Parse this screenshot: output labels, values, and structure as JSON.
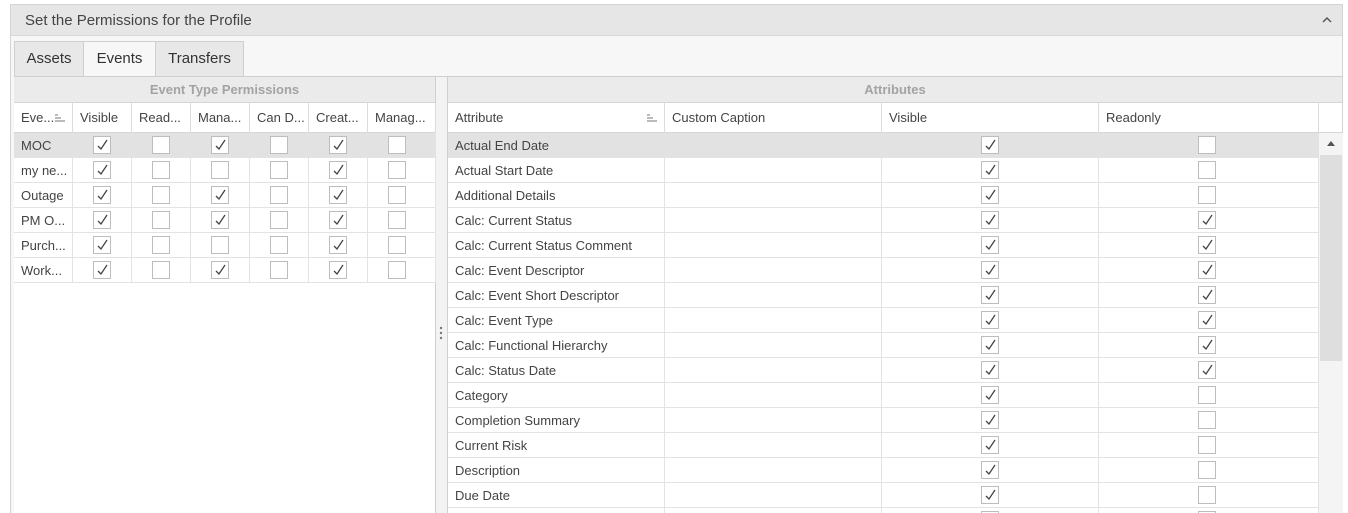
{
  "panel": {
    "title": "Set the Permissions for the Profile"
  },
  "tabs": [
    {
      "label": "Assets",
      "active": false
    },
    {
      "label": "Events",
      "active": true
    },
    {
      "label": "Transfers",
      "active": false
    }
  ],
  "left": {
    "band": "Event Type Permissions",
    "columns": [
      "Eve...",
      "Visible",
      "Read...",
      "Mana...",
      "Can D...",
      "Creat...",
      "Manag..."
    ],
    "rows": [
      {
        "name": "MOC",
        "checks": [
          true,
          false,
          true,
          false,
          true,
          false
        ],
        "selected": true
      },
      {
        "name": "my ne...",
        "checks": [
          true,
          false,
          false,
          false,
          true,
          false
        ],
        "selected": false
      },
      {
        "name": "Outage",
        "checks": [
          true,
          false,
          true,
          false,
          true,
          false
        ],
        "selected": false
      },
      {
        "name": "PM O...",
        "checks": [
          true,
          false,
          true,
          false,
          true,
          false
        ],
        "selected": false
      },
      {
        "name": "Purch...",
        "checks": [
          true,
          false,
          false,
          false,
          true,
          false
        ],
        "selected": false
      },
      {
        "name": "Work...",
        "checks": [
          true,
          false,
          true,
          false,
          true,
          false
        ],
        "selected": false
      }
    ]
  },
  "right": {
    "band": "Attributes",
    "columns": [
      "Attribute",
      "Custom Caption",
      "Visible",
      "Readonly"
    ],
    "rows": [
      {
        "attribute": "Actual End Date",
        "caption": "",
        "visible": true,
        "readonly": false,
        "selected": true
      },
      {
        "attribute": "Actual Start Date",
        "caption": "",
        "visible": true,
        "readonly": false,
        "selected": false
      },
      {
        "attribute": "Additional Details",
        "caption": "",
        "visible": true,
        "readonly": false,
        "selected": false
      },
      {
        "attribute": "Calc: Current Status",
        "caption": "",
        "visible": true,
        "readonly": true,
        "selected": false
      },
      {
        "attribute": "Calc: Current Status Comment",
        "caption": "",
        "visible": true,
        "readonly": true,
        "selected": false
      },
      {
        "attribute": "Calc: Event Descriptor",
        "caption": "",
        "visible": true,
        "readonly": true,
        "selected": false
      },
      {
        "attribute": "Calc: Event Short Descriptor",
        "caption": "",
        "visible": true,
        "readonly": true,
        "selected": false
      },
      {
        "attribute": "Calc: Event Type",
        "caption": "",
        "visible": true,
        "readonly": true,
        "selected": false
      },
      {
        "attribute": "Calc: Functional Hierarchy",
        "caption": "",
        "visible": true,
        "readonly": true,
        "selected": false
      },
      {
        "attribute": "Calc: Status Date",
        "caption": "",
        "visible": true,
        "readonly": true,
        "selected": false
      },
      {
        "attribute": "Category",
        "caption": "",
        "visible": true,
        "readonly": false,
        "selected": false
      },
      {
        "attribute": "Completion Summary",
        "caption": "",
        "visible": true,
        "readonly": false,
        "selected": false
      },
      {
        "attribute": "Current Risk",
        "caption": "",
        "visible": true,
        "readonly": false,
        "selected": false
      },
      {
        "attribute": "Description",
        "caption": "",
        "visible": true,
        "readonly": false,
        "selected": false
      },
      {
        "attribute": "Due Date",
        "caption": "",
        "visible": true,
        "readonly": false,
        "selected": false
      },
      {
        "attribute": "",
        "caption": "",
        "visible": true,
        "readonly": false,
        "selected": false
      }
    ]
  },
  "icons": {
    "collapse": "chevron-up-icon",
    "sort": "sort-icon",
    "check": "check-icon",
    "splitter": "splitter-grip-icon",
    "scroll_up": "scroll-up-arrow-icon"
  }
}
